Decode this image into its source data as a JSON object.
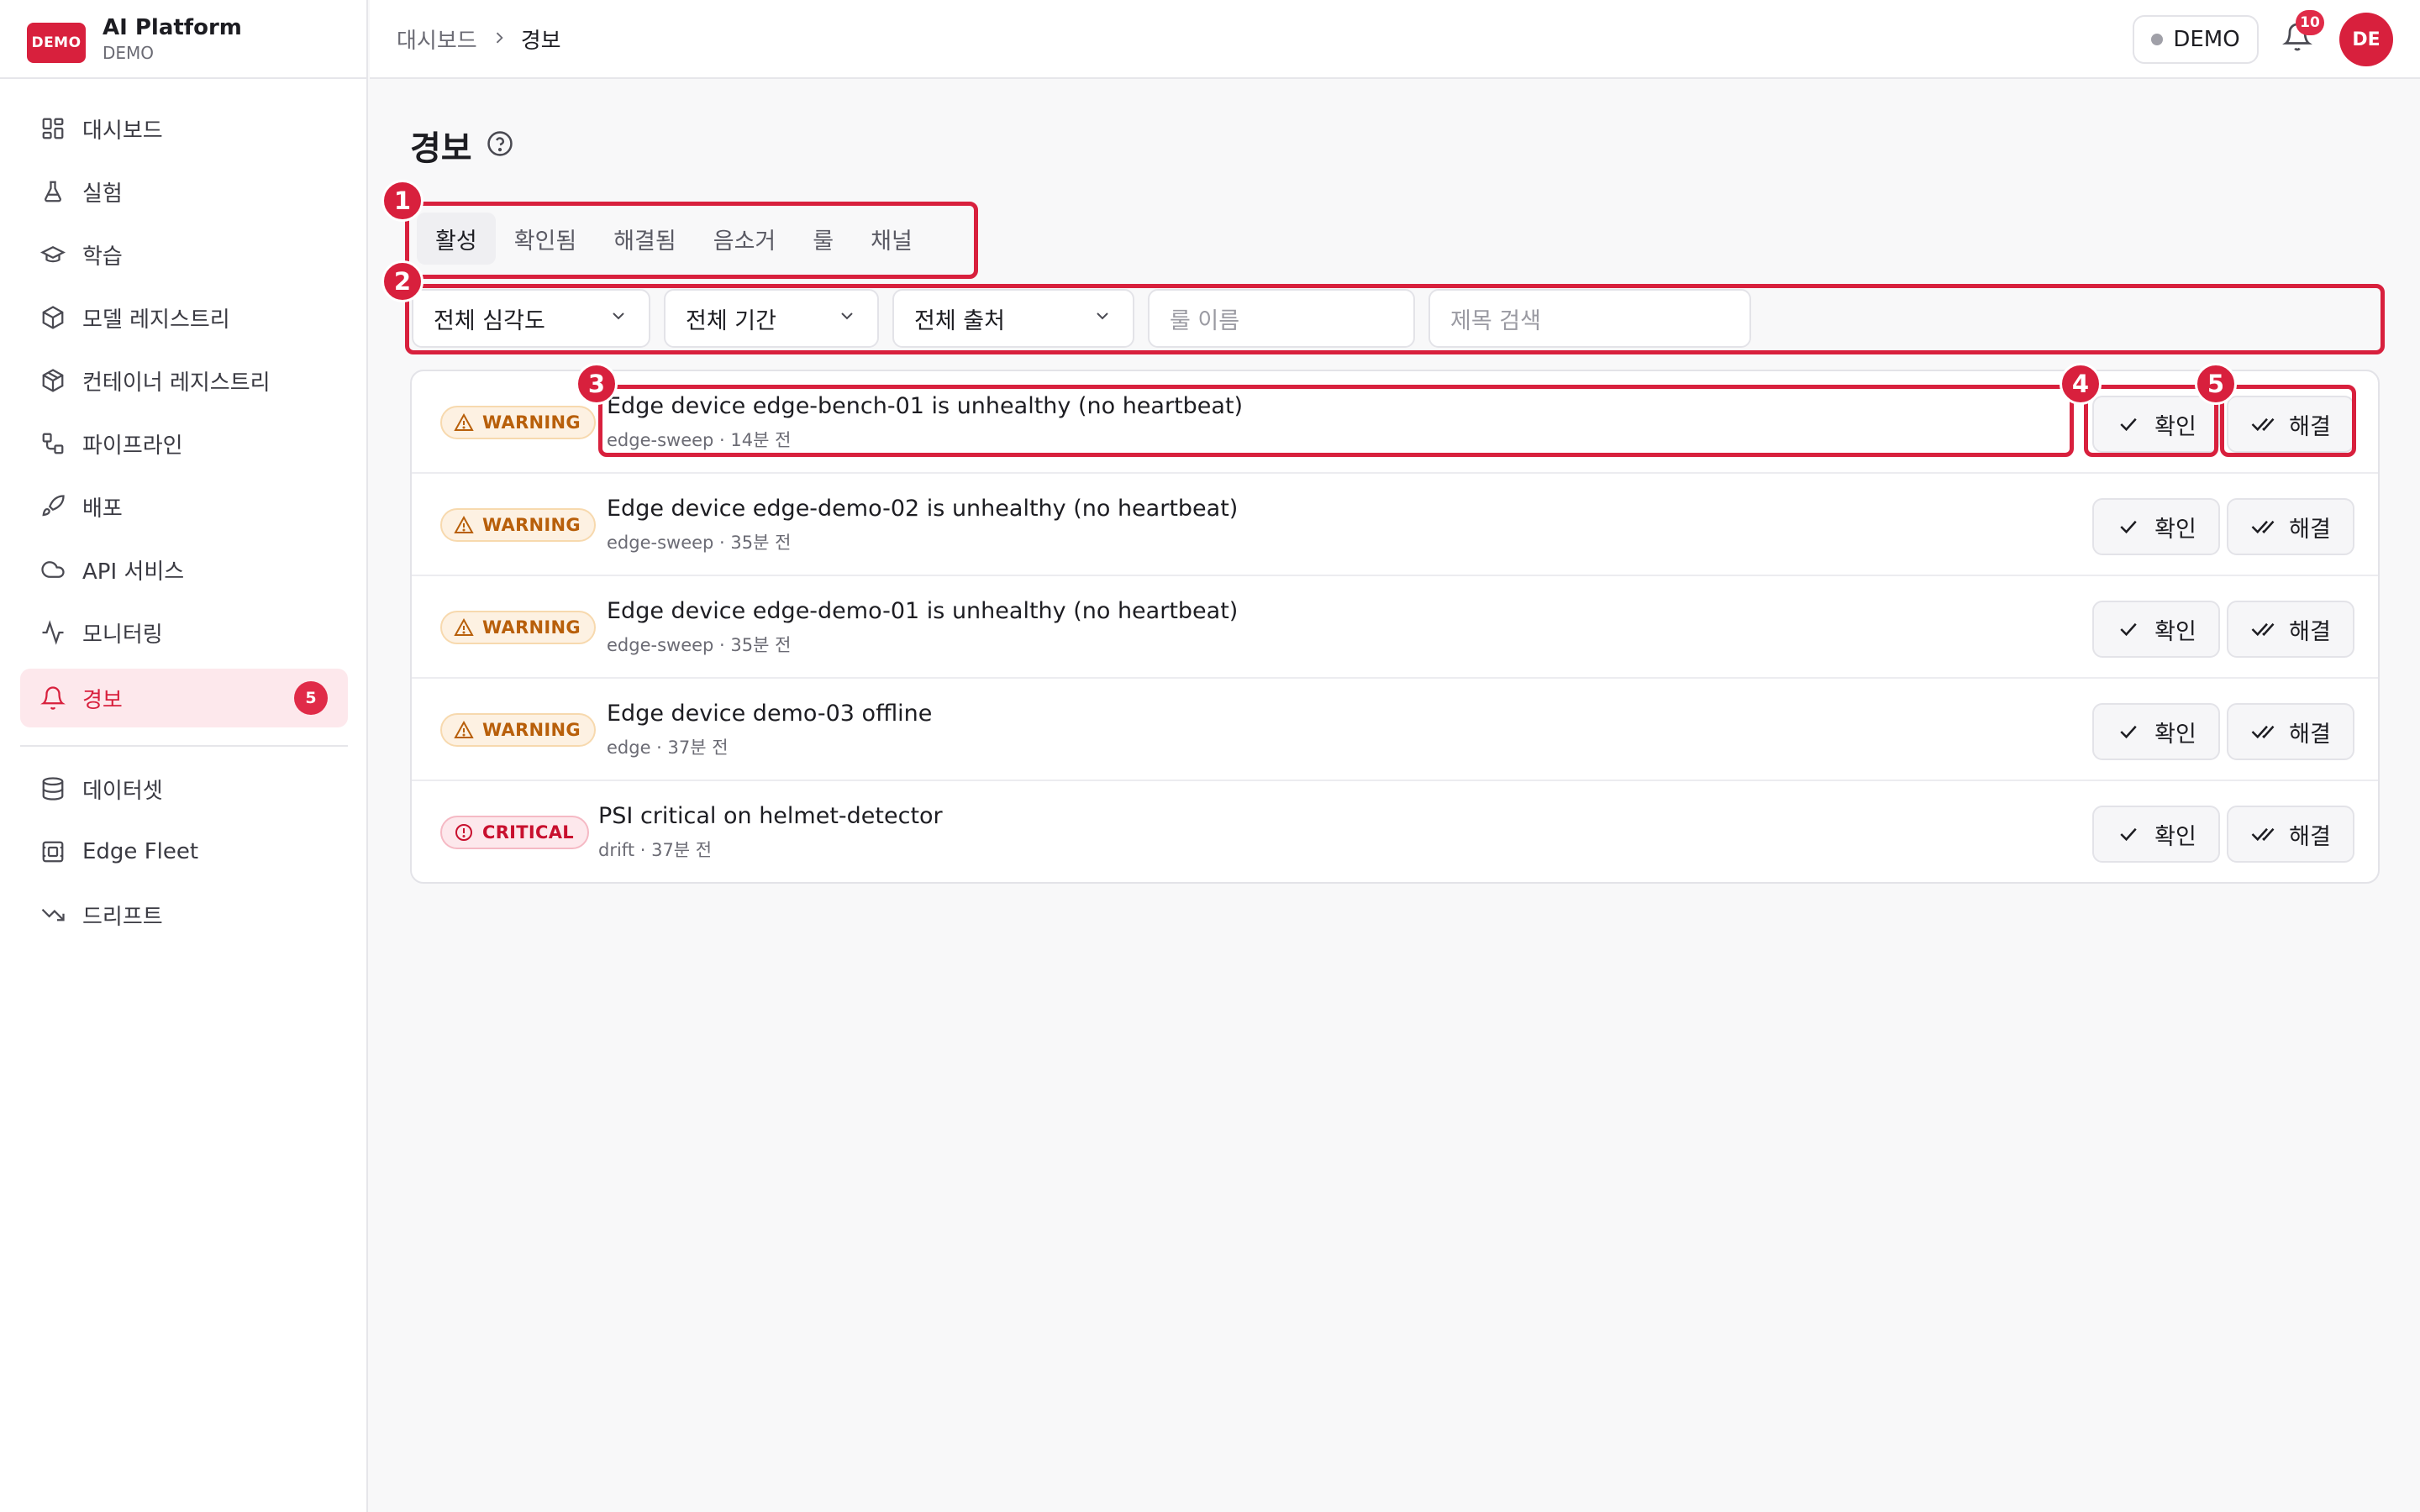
{
  "brand": {
    "logo": "DEMO",
    "name": "AI Platform",
    "env": "DEMO"
  },
  "sidebar": {
    "items": [
      {
        "label": "대시보드",
        "icon": "dashboard-icon"
      },
      {
        "label": "실험",
        "icon": "flask-icon"
      },
      {
        "label": "학습",
        "icon": "graduation-cap-icon"
      },
      {
        "label": "모델 레지스트리",
        "icon": "box-icon"
      },
      {
        "label": "컨테이너 레지스트리",
        "icon": "boxes-icon"
      },
      {
        "label": "파이프라인",
        "icon": "workflow-icon"
      },
      {
        "label": "배포",
        "icon": "rocket-icon"
      },
      {
        "label": "API 서비스",
        "icon": "cloud-icon"
      },
      {
        "label": "모니터링",
        "icon": "activity-icon"
      },
      {
        "label": "경보",
        "icon": "bell-icon",
        "badge": "5",
        "active": true
      },
      {
        "label": "데이터셋",
        "icon": "database-icon"
      },
      {
        "label": "Edge Fleet",
        "icon": "chip-icon"
      },
      {
        "label": "드리프트",
        "icon": "trending-down-icon"
      }
    ]
  },
  "header": {
    "breadcrumb": {
      "parent": "대시보드",
      "current": "경보"
    },
    "env_label": "DEMO",
    "notification_count": "10",
    "avatar_initials": "DE"
  },
  "page": {
    "title": "경보"
  },
  "tabs": [
    {
      "label": "활성",
      "active": true
    },
    {
      "label": "확인됨"
    },
    {
      "label": "해결됨"
    },
    {
      "label": "음소거"
    },
    {
      "label": "룰"
    },
    {
      "label": "채널"
    }
  ],
  "filters": {
    "severity": "전체 심각도",
    "period": "전체 기간",
    "source": "전체 출처",
    "rule_placeholder": "룰 이름",
    "search_placeholder": "제목 검색"
  },
  "alerts": [
    {
      "severity": "WARNING",
      "title": "Edge device edge-bench-01 is unhealthy (no heartbeat)",
      "meta": "edge-sweep · 14분 전"
    },
    {
      "severity": "WARNING",
      "title": "Edge device edge-demo-02 is unhealthy (no heartbeat)",
      "meta": "edge-sweep · 35분 전"
    },
    {
      "severity": "WARNING",
      "title": "Edge device edge-demo-01 is unhealthy (no heartbeat)",
      "meta": "edge-sweep · 35분 전"
    },
    {
      "severity": "WARNING",
      "title": "Edge device demo-03 offline",
      "meta": "edge · 37분 전"
    },
    {
      "severity": "CRITICAL",
      "title": "PSI critical on helmet-detector",
      "meta": "drift · 37분 전"
    }
  ],
  "actions": {
    "ack_label": "확인",
    "resolve_label": "해결"
  },
  "annotations": [
    "1",
    "2",
    "3",
    "4",
    "5"
  ],
  "colors": {
    "accent": "#d8203d",
    "warning": "#b85f0a",
    "critical": "#c8102e"
  }
}
